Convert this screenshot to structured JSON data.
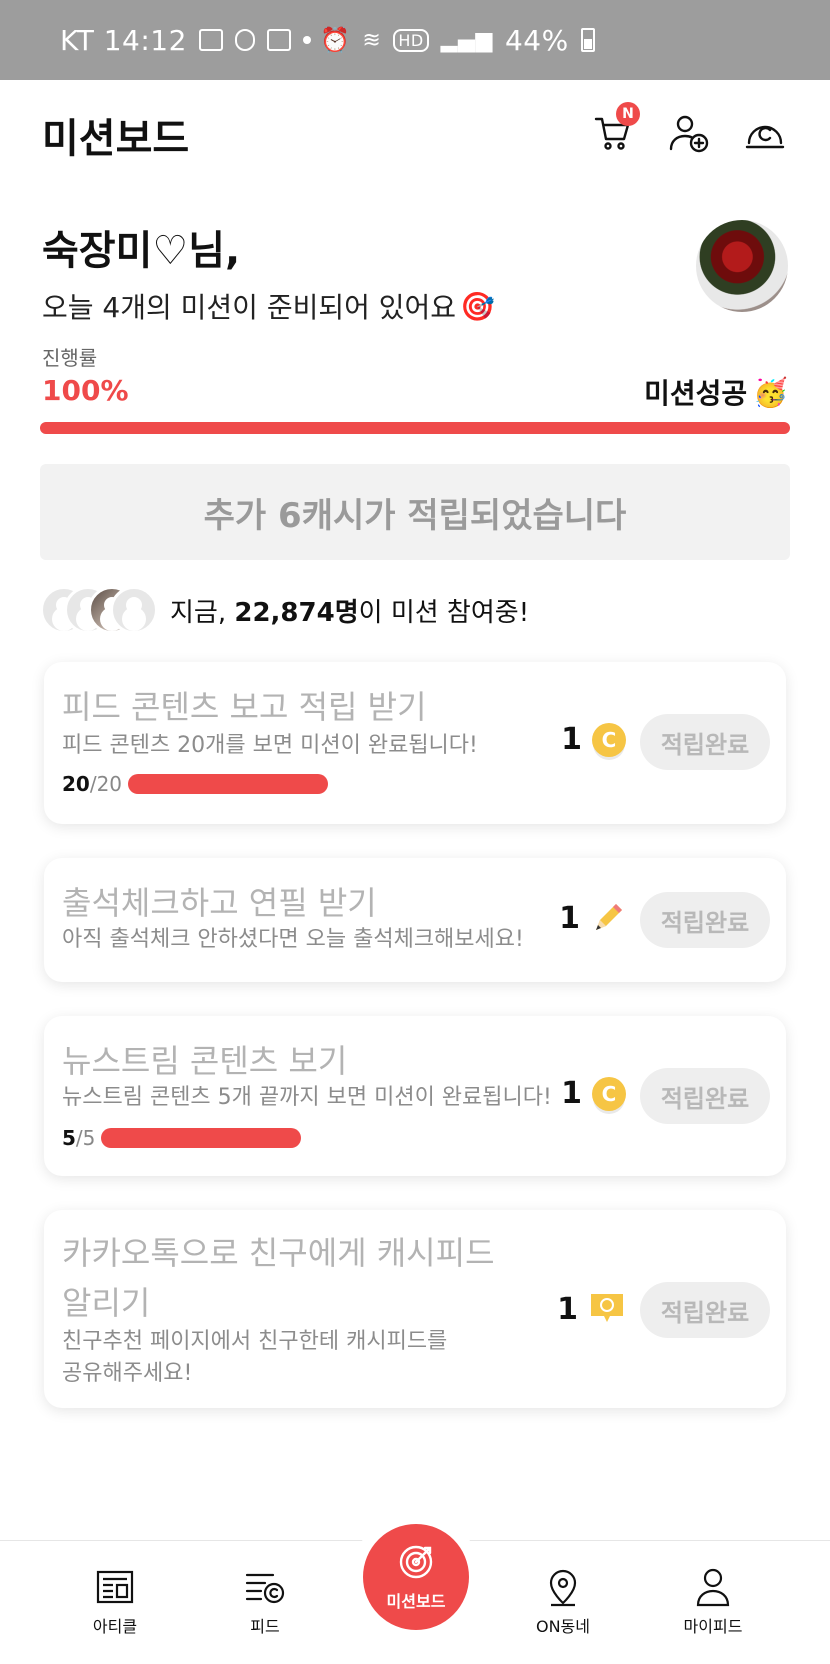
{
  "status_bar": {
    "carrier_time": "KT 14:12",
    "battery": "44%",
    "network": "HD"
  },
  "header": {
    "title": "미션보드",
    "cart_badge": "N"
  },
  "greeting": {
    "name": "숙장미♡님,",
    "subtitle": "오늘 4개의 미션이 준비되어 있어요",
    "subtitle_emoji": "🎯"
  },
  "progress": {
    "label": "진행률",
    "value": "100%",
    "percent": 100,
    "status": "미션성공",
    "status_emoji": "🥳"
  },
  "banner": {
    "text": "추가 6캐시가 적립되었습니다"
  },
  "participants": {
    "prefix": "지금, ",
    "count": "22,874명",
    "suffix": "이 미션 참여중!"
  },
  "missions": [
    {
      "title": "피드 콘텐츠 보고 적립 받기",
      "desc": "피드 콘텐츠 20개를 보면 미션이 완료됩니다!",
      "done": "20",
      "total": "/20",
      "reward": "1",
      "reward_icon": "coin-icon",
      "button": "적립완료"
    },
    {
      "title": "출석체크하고 연필 받기",
      "desc": "아직 출석체크 안하셨다면 오늘 출석체크해보세요!",
      "reward": "1",
      "reward_icon": "pencil-icon",
      "button": "적립완료"
    },
    {
      "title": "뉴스트림 콘텐츠 보기",
      "desc": "뉴스트림 콘텐츠 5개 끝까지 보면 미션이 완료됩니다!",
      "done": "5",
      "total": "/5",
      "reward": "1",
      "reward_icon": "coin-icon",
      "button": "적립완료"
    },
    {
      "title_line1": "카카오톡으로 친구에게 캐시피드",
      "title_line2": "알리기",
      "desc_line1": "친구추천 페이지에서 친구한테 캐시피드를",
      "desc_line2": "공유해주세요!",
      "reward": "1",
      "reward_icon": "chat-coin-icon",
      "button": "적립완료"
    }
  ],
  "nav": {
    "article": "아티클",
    "feed": "피드",
    "mission": "미션보드",
    "on_dongne": "ON동네",
    "my_feed": "마이피드"
  },
  "colors": {
    "accent": "#ef4a4a",
    "coin": "#f6c544",
    "muted": "#b3b3b3"
  }
}
